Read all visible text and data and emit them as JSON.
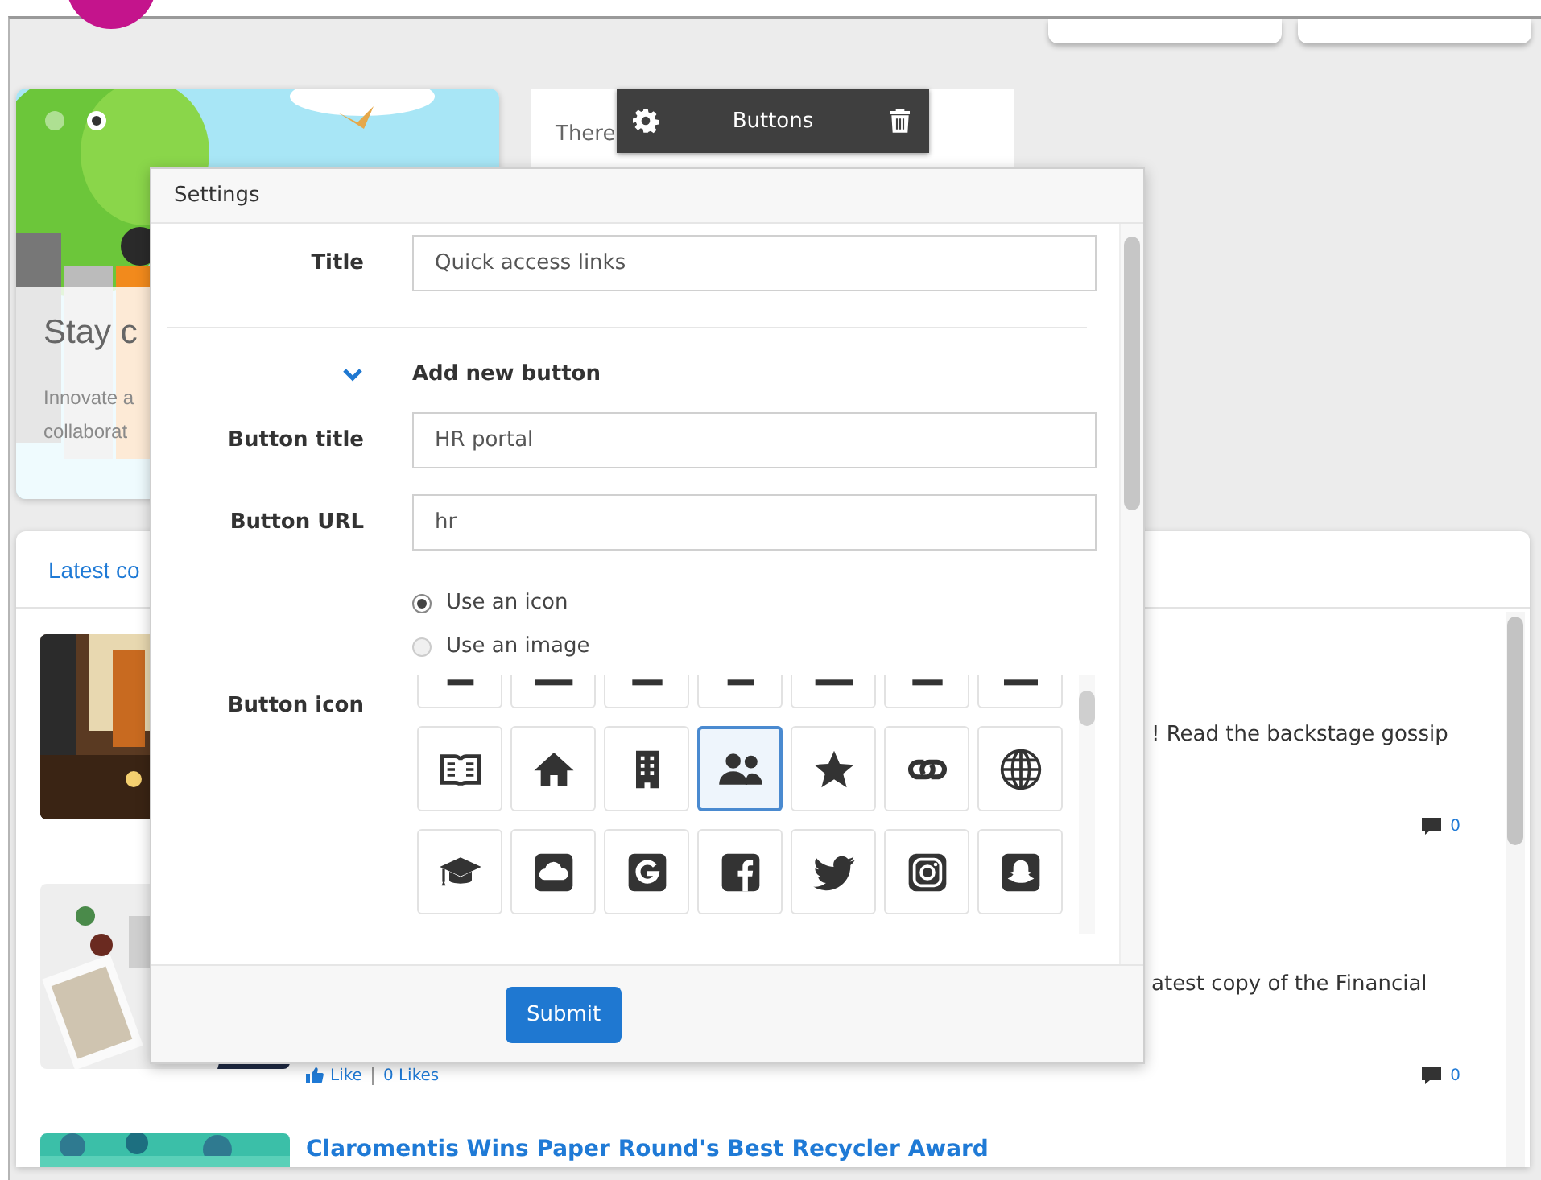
{
  "hero": {
    "title": "Stay c",
    "lines": [
      "Innovate a",
      "collaborat"
    ],
    "dots": [
      {
        "selected": false
      },
      {
        "selected": true
      }
    ]
  },
  "buttons_widget": {
    "text": "There"
  },
  "widget_toolbar": {
    "title": "Buttons"
  },
  "latest": {
    "title": "Latest co",
    "items": [
      {
        "excerpt": "! Read the backstage gossip",
        "comments": "0"
      },
      {
        "excerpt": "atest copy of the Financial",
        "like": "Like",
        "likes": "0 Likes",
        "comments": "0"
      },
      {
        "title": "Claromentis Wins Paper Round's Best Recycler Award"
      }
    ]
  },
  "settings": {
    "title": "Settings",
    "title_field": {
      "label": "Title",
      "value": "Quick access links"
    },
    "section": {
      "label": "Add new button",
      "expanded": true
    },
    "fields": [
      {
        "label": "Button title",
        "value": "HR portal"
      },
      {
        "label": "Button URL",
        "value": "hr"
      }
    ],
    "icon_source": [
      {
        "label": "Use an icon",
        "selected": true
      },
      {
        "label": "Use an image",
        "selected": false
      }
    ],
    "icon_label": "Button icon",
    "icon_rows": [
      [
        {
          "selected": false
        },
        {
          "selected": false
        },
        {
          "selected": false
        },
        {
          "selected": false
        },
        {
          "selected": false
        },
        {
          "selected": false
        },
        {
          "selected": false
        }
      ],
      [
        {
          "selected": false
        },
        {
          "selected": false
        },
        {
          "selected": false
        },
        {
          "selected": true
        },
        {
          "selected": false
        },
        {
          "selected": false
        },
        {
          "selected": false
        }
      ],
      [
        {
          "selected": false
        },
        {
          "selected": false
        },
        {
          "selected": false
        },
        {
          "selected": false
        },
        {
          "selected": false
        },
        {
          "selected": false
        },
        {
          "selected": false
        }
      ]
    ],
    "submit": "Submit"
  }
}
